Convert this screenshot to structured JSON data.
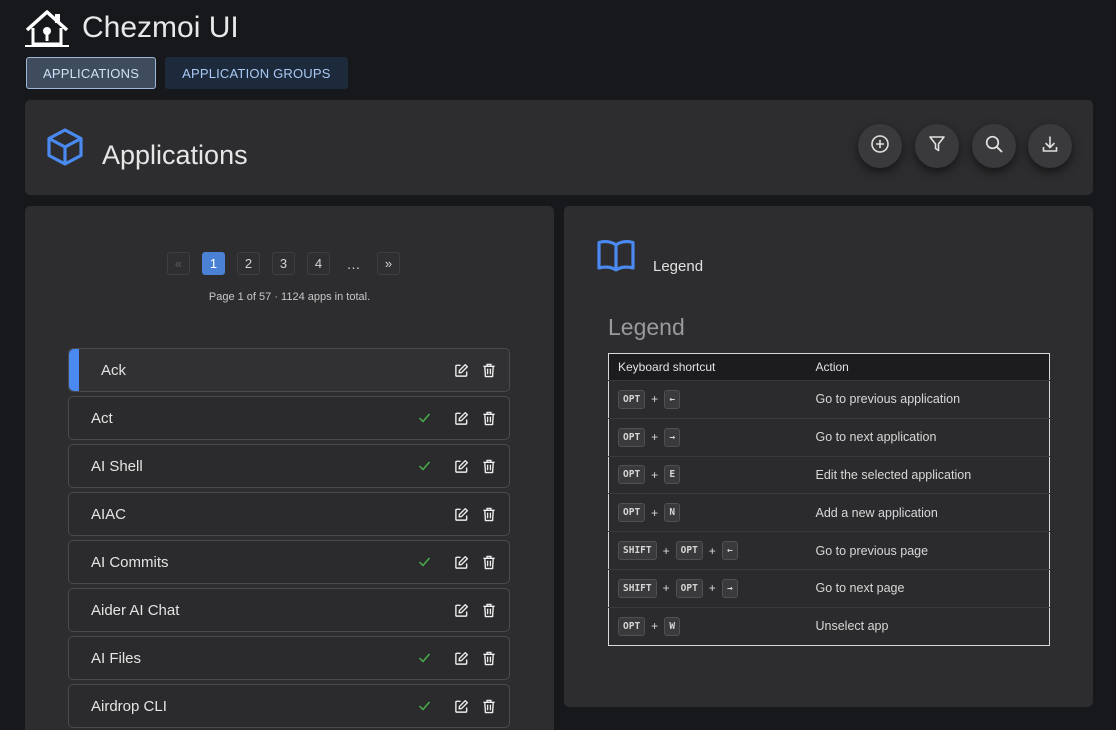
{
  "app": {
    "title": "Chezmoi UI",
    "logo_icon": "house-key-icon"
  },
  "nav": {
    "tabs": [
      {
        "label": "APPLICATIONS",
        "active": true
      },
      {
        "label": "APPLICATION GROUPS",
        "active": false
      }
    ]
  },
  "banner": {
    "title": "Applications",
    "icon": "cube-icon",
    "actions": [
      {
        "name": "add-icon"
      },
      {
        "name": "filter-icon"
      },
      {
        "name": "search-icon"
      },
      {
        "name": "download-icon"
      }
    ]
  },
  "pagination": {
    "first": "«",
    "last": "»",
    "pages": [
      "1",
      "2",
      "3",
      "4"
    ],
    "current": "1",
    "ellipsis": "…",
    "info": "Page 1 of 57 · 1124 apps in total."
  },
  "apps": [
    {
      "name": "Ack",
      "selected": true,
      "checked": false
    },
    {
      "name": "Act",
      "selected": false,
      "checked": true
    },
    {
      "name": "AI Shell",
      "selected": false,
      "checked": true
    },
    {
      "name": "AIAC",
      "selected": false,
      "checked": false
    },
    {
      "name": "AI Commits",
      "selected": false,
      "checked": true
    },
    {
      "name": "Aider AI Chat",
      "selected": false,
      "checked": false
    },
    {
      "name": "AI Files",
      "selected": false,
      "checked": true
    },
    {
      "name": "Airdrop CLI",
      "selected": false,
      "checked": true
    }
  ],
  "legend": {
    "header": "Legend",
    "title": "Legend",
    "columns": [
      "Keyboard shortcut",
      "Action"
    ],
    "rows": [
      {
        "keys": [
          "OPT",
          "←"
        ],
        "action": "Go to previous application"
      },
      {
        "keys": [
          "OPT",
          "→"
        ],
        "action": "Go to next application"
      },
      {
        "keys": [
          "OPT",
          "E"
        ],
        "action": "Edit the selected application"
      },
      {
        "keys": [
          "OPT",
          "N"
        ],
        "action": "Add a new application"
      },
      {
        "keys": [
          "SHIFT",
          "OPT",
          "←"
        ],
        "action": "Go to previous page"
      },
      {
        "keys": [
          "SHIFT",
          "OPT",
          "→"
        ],
        "action": "Go to next page"
      },
      {
        "keys": [
          "OPT",
          "W"
        ],
        "action": "Unselect app"
      }
    ]
  },
  "colors": {
    "accent": "#4a8af0",
    "check": "#4caf50",
    "background": "#16181c",
    "panel": "#2d2d2f"
  }
}
